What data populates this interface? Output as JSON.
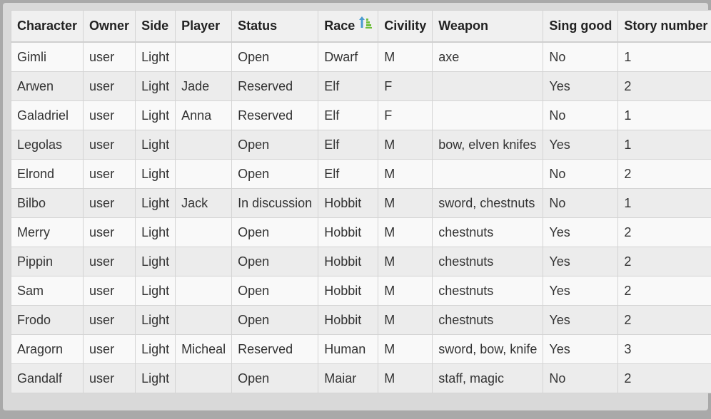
{
  "table": {
    "columns": [
      {
        "key": "character",
        "label": "Character"
      },
      {
        "key": "owner",
        "label": "Owner"
      },
      {
        "key": "side",
        "label": "Side"
      },
      {
        "key": "player",
        "label": "Player"
      },
      {
        "key": "status",
        "label": "Status"
      },
      {
        "key": "race",
        "label": "Race",
        "sort_icon": "sort-ascending-icon"
      },
      {
        "key": "civility",
        "label": "Civility"
      },
      {
        "key": "weapon",
        "label": "Weapon"
      },
      {
        "key": "sing_good",
        "label": "Sing good"
      },
      {
        "key": "story_number",
        "label": "Story number"
      }
    ],
    "rows": [
      {
        "character": "Gimli",
        "owner": "user",
        "side": "Light",
        "player": "",
        "status": "Open",
        "race": "Dwarf",
        "civility": "M",
        "weapon": "axe",
        "sing_good": "No",
        "story_number": "1"
      },
      {
        "character": "Arwen",
        "owner": "user",
        "side": "Light",
        "player": "Jade",
        "status": "Reserved",
        "race": "Elf",
        "civility": "F",
        "weapon": "",
        "sing_good": "Yes",
        "story_number": "2"
      },
      {
        "character": "Galadriel",
        "owner": "user",
        "side": "Light",
        "player": "Anna",
        "status": "Reserved",
        "race": "Elf",
        "civility": "F",
        "weapon": "",
        "sing_good": "No",
        "story_number": "1"
      },
      {
        "character": "Legolas",
        "owner": "user",
        "side": "Light",
        "player": "",
        "status": "Open",
        "race": "Elf",
        "civility": "M",
        "weapon": "bow, elven knifes",
        "sing_good": "Yes",
        "story_number": "1"
      },
      {
        "character": "Elrond",
        "owner": "user",
        "side": "Light",
        "player": "",
        "status": "Open",
        "race": "Elf",
        "civility": "M",
        "weapon": "",
        "sing_good": "No",
        "story_number": "2"
      },
      {
        "character": "Bilbo",
        "owner": "user",
        "side": "Light",
        "player": "Jack",
        "status": "In discussion",
        "race": "Hobbit",
        "civility": "M",
        "weapon": "sword, chestnuts",
        "sing_good": "No",
        "story_number": "1"
      },
      {
        "character": "Merry",
        "owner": "user",
        "side": "Light",
        "player": "",
        "status": "Open",
        "race": "Hobbit",
        "civility": "M",
        "weapon": "chestnuts",
        "sing_good": "Yes",
        "story_number": "2"
      },
      {
        "character": "Pippin",
        "owner": "user",
        "side": "Light",
        "player": "",
        "status": "Open",
        "race": "Hobbit",
        "civility": "M",
        "weapon": "chestnuts",
        "sing_good": "Yes",
        "story_number": "2"
      },
      {
        "character": "Sam",
        "owner": "user",
        "side": "Light",
        "player": "",
        "status": "Open",
        "race": "Hobbit",
        "civility": "M",
        "weapon": "chestnuts",
        "sing_good": "Yes",
        "story_number": "2"
      },
      {
        "character": "Frodo",
        "owner": "user",
        "side": "Light",
        "player": "",
        "status": "Open",
        "race": "Hobbit",
        "civility": "M",
        "weapon": "chestnuts",
        "sing_good": "Yes",
        "story_number": "2"
      },
      {
        "character": "Aragorn",
        "owner": "user",
        "side": "Light",
        "player": "Micheal",
        "status": "Reserved",
        "race": "Human",
        "civility": "M",
        "weapon": "sword, bow, knife",
        "sing_good": "Yes",
        "story_number": "3"
      },
      {
        "character": "Gandalf",
        "owner": "user",
        "side": "Light",
        "player": "",
        "status": "Open",
        "race": "Maiar",
        "civility": "M",
        "weapon": "staff, magic",
        "sing_good": "No",
        "story_number": "2"
      }
    ]
  }
}
